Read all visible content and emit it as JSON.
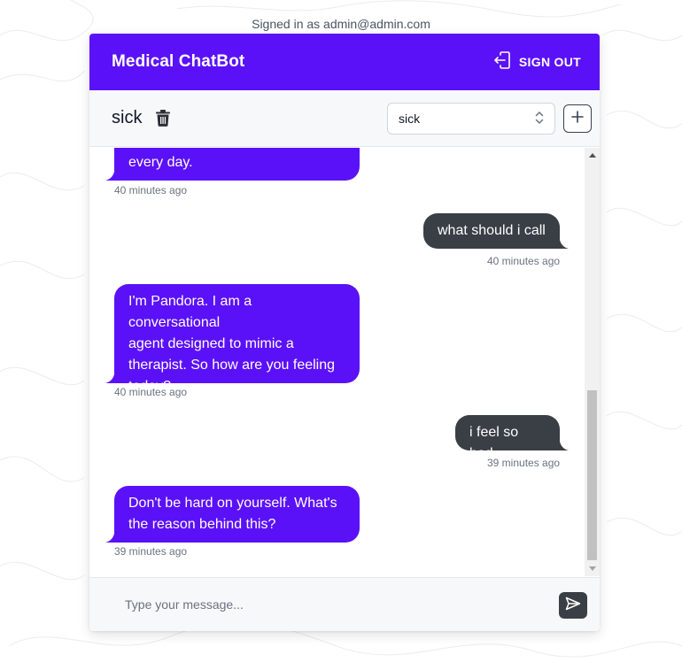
{
  "signed_in_text": "Signed in as admin@admin.com",
  "header": {
    "title": "Medical ChatBot",
    "signout_label": "SIGN OUT",
    "signout_icon": "logout-icon"
  },
  "toolbar": {
    "chat_name": "sick",
    "delete_icon": "trash-icon",
    "chat_select_value": "sick",
    "add_icon": "plus-icon"
  },
  "messages": [
    {
      "sender": "bot",
      "lines": [
        "every day."
      ],
      "time": "40 minutes ago"
    },
    {
      "sender": "user",
      "lines": [
        "what should i call"
      ],
      "time": "40 minutes ago"
    },
    {
      "sender": "bot",
      "lines": [
        "I'm Pandora. I am a conversational",
        "agent designed to mimic a",
        "therapist. So how are you feeling",
        "today?"
      ],
      "time": "40 minutes ago"
    },
    {
      "sender": "user",
      "lines": [
        "i feel so bad"
      ],
      "time": "39 minutes ago"
    },
    {
      "sender": "bot",
      "lines": [
        "Don't be hard on yourself. What's",
        "the reason behind this?"
      ],
      "time": "39 minutes ago"
    }
  ],
  "composer": {
    "placeholder": "Type your message...",
    "send_icon": "send-icon"
  },
  "colors": {
    "brand": "#5b11f7",
    "user_bubble": "#3a3f46"
  }
}
